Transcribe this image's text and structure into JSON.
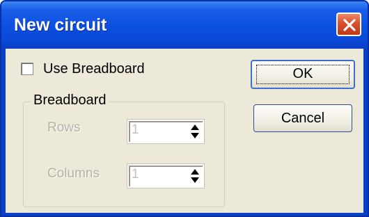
{
  "window": {
    "title": "New circuit"
  },
  "use_breadboard": {
    "label": "Use Breadboard",
    "checked": false
  },
  "breadboard_group": {
    "label": "Breadboard",
    "rows": {
      "label": "Rows",
      "value": "1"
    },
    "columns": {
      "label": "Columns",
      "value": "1"
    }
  },
  "buttons": {
    "ok": "OK",
    "cancel": "Cancel"
  },
  "colors": {
    "titlebar": "#0b4fe0",
    "close": "#d8502c",
    "dialog_bg": "#ece9d8",
    "disabled_text": "#b5b3a6"
  },
  "icons": {
    "close": "close-icon",
    "spin_up": "triangle-up-icon",
    "spin_down": "triangle-down-icon"
  }
}
